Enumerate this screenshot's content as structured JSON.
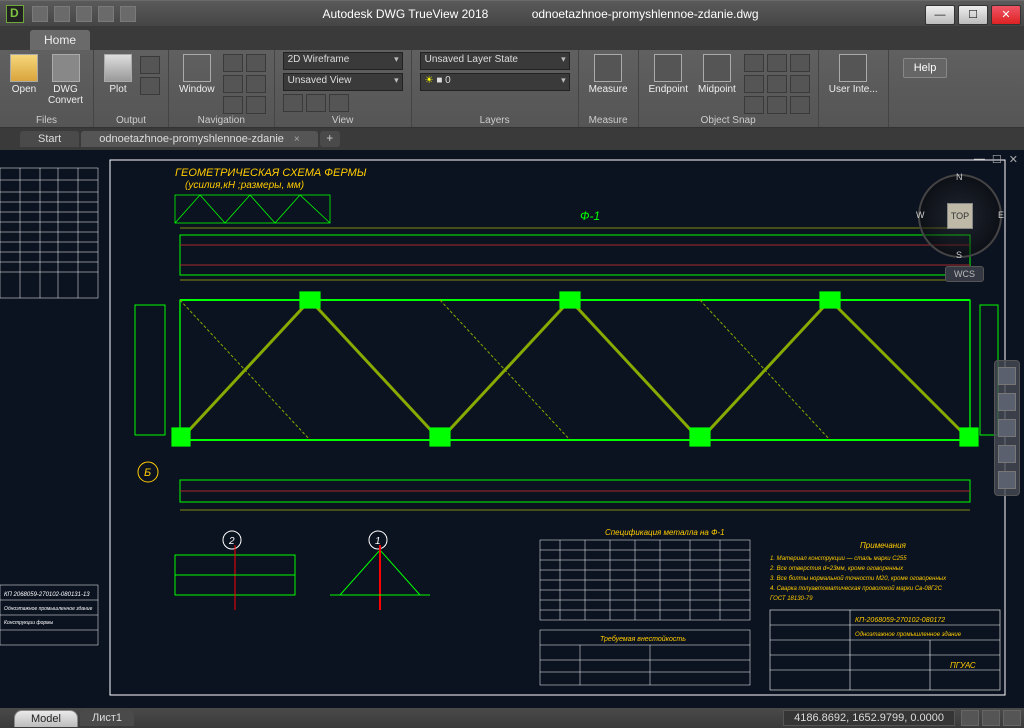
{
  "title": {
    "appname": "Autodesk DWG TrueView 2018",
    "filename": "odnoetazhnoe-promyshlennoe-zdanie.dwg"
  },
  "menu": {
    "home": "Home"
  },
  "ribbon": {
    "files": {
      "title": "Files",
      "open": "Open",
      "convert": "DWG\nConvert"
    },
    "output": {
      "title": "Output",
      "plot": "Plot"
    },
    "nav": {
      "title": "Navigation",
      "window": "Window"
    },
    "view": {
      "title": "View",
      "style": "2D Wireframe",
      "saved": "Unsaved View"
    },
    "layers": {
      "title": "Layers",
      "state": "Unsaved Layer State",
      "current": "0"
    },
    "measure": {
      "title": "Measure",
      "btn": "Measure"
    },
    "osnap": {
      "title": "Object Snap",
      "endpoint": "Endpoint",
      "midpoint": "Midpoint"
    },
    "userint": "User Inte...",
    "help": "Help"
  },
  "doctabs": {
    "start": "Start",
    "file": "odnoetazhnoe-promyshlennoe-zdanie"
  },
  "viewcube": {
    "top": "TOP",
    "n": "N",
    "e": "E",
    "s": "S",
    "w": "W",
    "wcs": "WCS"
  },
  "drawing": {
    "header1": "ГЕОМЕТРИЧЕСКАЯ СХЕМА ФЕРМЫ",
    "header2": "(усилия,кН ;размеры, мм)",
    "mark_f1": "Ф-1",
    "axis_b": "Б",
    "detail_1": "1",
    "detail_2": "2",
    "spec_title": "Спецификация металла на Ф-1",
    "notes_title": "Примечания",
    "note1": "1. Материал конструкции — сталь марки С255",
    "note2": "2. Все отверстия d=23мм, кроме оговоренных",
    "note3": "3. Все болты нормальной точности М20, кроме оговоренных",
    "note4": "4. Сварка полуавтоматическая проволокой марки Св-08Г2С",
    "note5": "ГОСТ 18130-79",
    "stamp": "КП-2068059-270102-080172",
    "stamp2": "Одноэтажное промышленное здание",
    "pik": "ПГУАС",
    "tb_title": "Требуемая внестойкость",
    "left6": "КП 2068059-270102-080131-13",
    "left7": "Одноэтажное промышленное здание",
    "left8": "Конструкции формы"
  },
  "status": {
    "model": "Model",
    "layout": "Лист1",
    "coords": "4186.8692, 1652.9799, 0.0000"
  }
}
